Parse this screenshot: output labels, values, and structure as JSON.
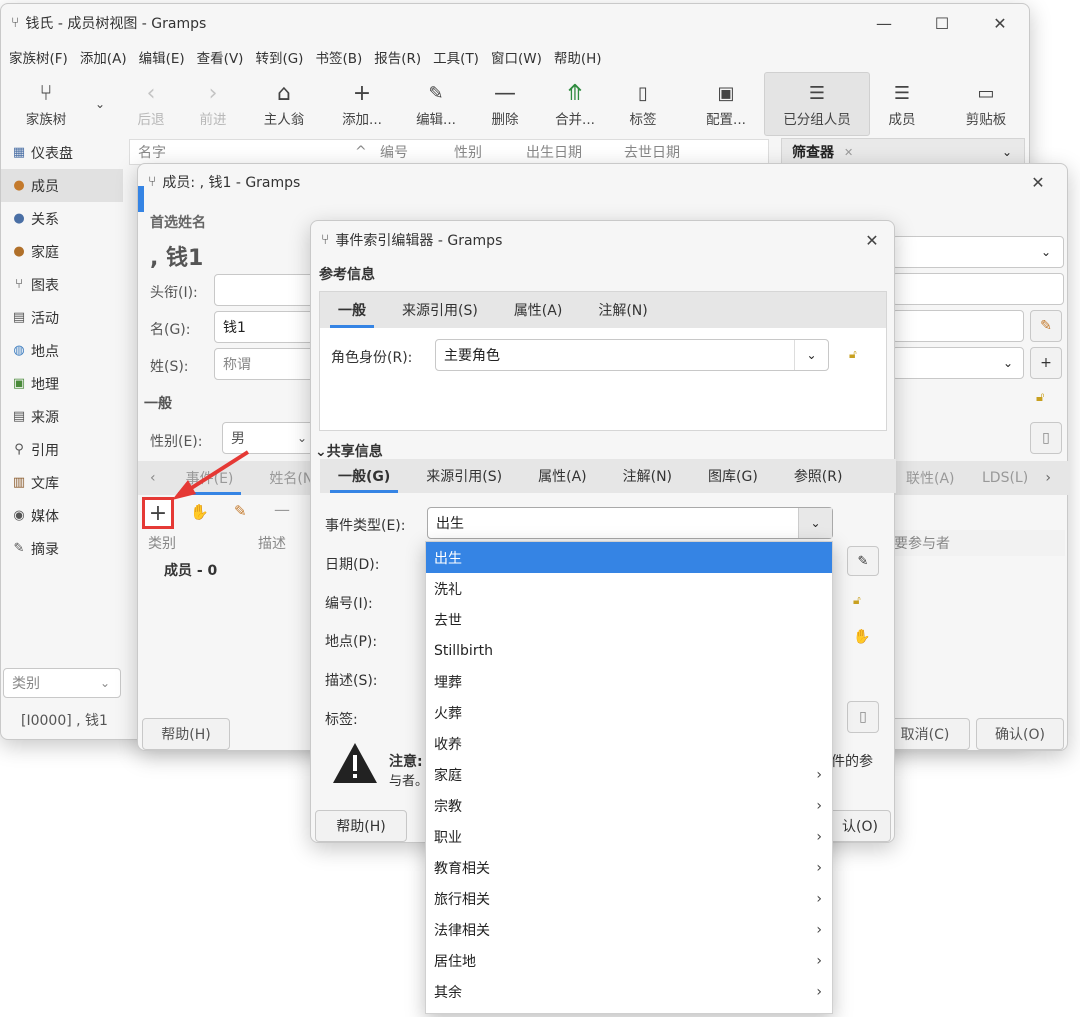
{
  "main": {
    "title": "钱氏 - 成员树视图 - Gramps",
    "menu": [
      "家族树(F)",
      "添加(A)",
      "编辑(E)",
      "查看(V)",
      "转到(G)",
      "书签(B)",
      "报告(R)",
      "工具(T)",
      "窗口(W)",
      "帮助(H)"
    ],
    "toolbar": {
      "tree": "家族树",
      "back": "后退",
      "forward": "前进",
      "home": "主人翁",
      "add": "添加...",
      "edit": "编辑...",
      "remove": "删除",
      "merge": "合并...",
      "tag": "标签",
      "config": "配置...",
      "grouped": "已分组人员",
      "people": "成员",
      "clipboard": "剪贴板"
    },
    "sidebar": [
      "仪表盘",
      "成员",
      "关系",
      "家庭",
      "图表",
      "活动",
      "地点",
      "地理",
      "来源",
      "引用",
      "文库",
      "媒体",
      "摘录"
    ],
    "columns": {
      "name": "名字",
      "id": "编号",
      "gender": "性别",
      "birth": "出生日期",
      "death": "去世日期"
    },
    "filter_tab": "筛查器",
    "category": "类别",
    "status": "[I0000] , 钱1"
  },
  "person": {
    "title": "成员: , 钱1 - Gramps",
    "preferred": "首选姓名",
    "display": ", 钱1",
    "title_label": "头衔(I):",
    "given_label": "名(G):",
    "given": "钱1",
    "surname_label": "姓(S):",
    "surname_placeholder": "称谓",
    "general": "一般",
    "gender_label": "性别(E):",
    "gender": "男",
    "tabs": [
      "事件(E)",
      "姓名(N)"
    ],
    "tabs_right": [
      "联性(A)",
      "LDS(L)"
    ],
    "evt_cols": {
      "type": "类别",
      "desc": "描述",
      "main": "要参与者"
    },
    "group": "成员 - 0",
    "help": "帮助(H)",
    "cancel": "取消(C)",
    "ok": "确认(O)"
  },
  "event": {
    "title": "事件索引编辑器 - Gramps",
    "ref_info": "参考信息",
    "ref_tabs": [
      "一般",
      "来源引用(S)",
      "属性(A)",
      "注解(N)"
    ],
    "role_label": "角色身份(R):",
    "role": "主要角色",
    "shared": "共享信息",
    "shared_tabs": [
      "一般(G)",
      "来源引用(S)",
      "属性(A)",
      "注解(N)",
      "图库(G)",
      "参照(R)"
    ],
    "type_label": "事件类型(E):",
    "type": "出生",
    "date_label": "日期(D):",
    "id_label": "编号(I):",
    "place_label": "地点(P):",
    "desc_label": "描述(S):",
    "tag_label": "标签:",
    "note_title": "注意:",
    "note_text": "与者。",
    "note_right": "件的参",
    "help": "帮助(H)",
    "ok": "认(O)"
  },
  "dropdown": [
    {
      "t": "出生",
      "sub": false
    },
    {
      "t": "洗礼",
      "sub": false
    },
    {
      "t": "去世",
      "sub": false
    },
    {
      "t": "Stillbirth",
      "sub": false
    },
    {
      "t": "埋葬",
      "sub": false
    },
    {
      "t": "火葬",
      "sub": false
    },
    {
      "t": "收养",
      "sub": false
    },
    {
      "t": "家庭",
      "sub": true
    },
    {
      "t": "宗教",
      "sub": true
    },
    {
      "t": "职业",
      "sub": true
    },
    {
      "t": "教育相关",
      "sub": true
    },
    {
      "t": "旅行相关",
      "sub": true
    },
    {
      "t": "法律相关",
      "sub": true
    },
    {
      "t": "居住地",
      "sub": true
    },
    {
      "t": "其余",
      "sub": true
    }
  ],
  "colors": {
    "accent": "#3584e4",
    "highlight": "#e53935"
  }
}
